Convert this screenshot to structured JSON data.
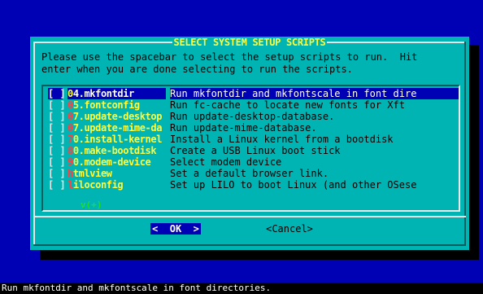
{
  "dialog": {
    "title": "SELECT SYSTEM SETUP SCRIPTS",
    "instructions": "Please use the spacebar to select the setup scripts to run.  Hit\nenter when you are done selecting to run the scripts.",
    "more_indicator": "v(+)",
    "items": [
      {
        "check": "[ ]",
        "hot": "0",
        "rest": "4.mkfontdir",
        "desc": "Run mkfontdir and mkfontscale in font dire",
        "selected": true
      },
      {
        "check": "[ ]",
        "hot": "0",
        "rest": "5.fontconfig",
        "desc": "Run fc-cache to locate new fonts for Xft",
        "selected": false
      },
      {
        "check": "[ ]",
        "hot": "0",
        "rest": "7.update-desktop",
        "desc": "Run update-desktop-database.",
        "selected": false
      },
      {
        "check": "[ ]",
        "hot": "0",
        "rest": "7.update-mime-da",
        "desc": "Run update-mime-database.",
        "selected": false
      },
      {
        "check": "[ ]",
        "hot": "7",
        "rest": "0.install-kernel",
        "desc": "Install a Linux kernel from a bootdisk",
        "selected": false
      },
      {
        "check": "[ ]",
        "hot": "8",
        "rest": "0.make-bootdisk",
        "desc": "Create a USB Linux boot stick",
        "selected": false
      },
      {
        "check": "[ ]",
        "hot": "9",
        "rest": "0.modem-device",
        "desc": "Select modem device",
        "selected": false
      },
      {
        "check": "[ ]",
        "hot": "h",
        "rest": "tmlview",
        "desc": "Set a default browser link.",
        "selected": false
      },
      {
        "check": "[ ]",
        "hot": "l",
        "rest": "iloconfig",
        "desc": "Set up LILO to boot Linux (and other OSese",
        "selected": false
      }
    ],
    "buttons": {
      "ok": "<  OK  >",
      "cancel": "<Cancel>"
    }
  },
  "statusbar": {
    "text": "Run mkfontdir and mkfontscale in font directories."
  },
  "colors": {
    "background": "#0000b4",
    "dialog": "#00b4b4",
    "highlight": "#0000b4",
    "title": "#ffff3c",
    "hotkey": "#ff4040"
  }
}
